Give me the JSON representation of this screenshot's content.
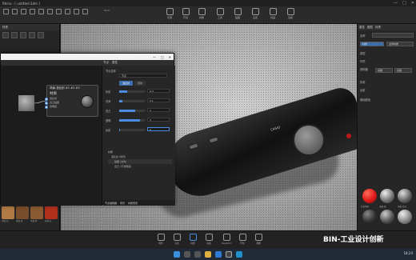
{
  "window": {
    "title": "Rhino - [ untitled.3dm ]",
    "controls": [
      "—",
      "□",
      "✕"
    ]
  },
  "toolbar": {
    "zoom_value": "50.0",
    "groups": [
      "选择",
      "变换",
      "视图",
      "渲染",
      "动画",
      "光照",
      "相机",
      "材质",
      "图层",
      "工具"
    ],
    "big_buttons": [
      "光源",
      "环境",
      "材质",
      "工具",
      "贴图",
      "设置",
      "动画",
      "渲染"
    ]
  },
  "left_panel": {
    "title": "材质",
    "thumbs": [
      "木纹-光",
      "木纹-深",
      "木纹-棕",
      "布料-红",
      "金属-灰",
      "金属-红",
      "玻璃",
      "塑料"
    ]
  },
  "dialog": {
    "title_controls": [
      "—",
      "□",
      "✕"
    ],
    "menu": [
      "节点",
      "属性"
    ],
    "node": {
      "header": "场景-漫反射 #1 #2 #3",
      "title": "材质",
      "ports": [
        "漫反射",
        "凹凸贴图",
        "透明度"
      ]
    },
    "props": {
      "name_label": "节点名称",
      "name_value": "节点",
      "tabs": [
        "漫反射",
        "折射"
      ],
      "rows": [
        {
          "label": "折射",
          "value": "0.3"
        },
        {
          "label": "光泽",
          "value": "0.1"
        },
        {
          "label": "凹凸",
          "value": "1"
        },
        {
          "label": "透明",
          "value": "2"
        },
        {
          "label": "反射",
          "value": "0"
        }
      ],
      "tree_title": "材质",
      "tree": [
        "漫反射 (场景)",
        "贴图 (文件)",
        "凹凸 (不透明度)"
      ],
      "footer": [
        "节点编辑器",
        "场景",
        "材质预览"
      ]
    }
  },
  "viewport": {
    "brand": "CASIO"
  },
  "right_panel": {
    "tabs": [
      "属性",
      "图层",
      "材质"
    ],
    "rows": [
      "名称",
      "类型",
      "环境",
      "透明度",
      "折射",
      "反射",
      "基础颜色"
    ],
    "buttons": [
      "材质",
      "全局材质",
      "基础",
      "高级"
    ],
    "materials": [
      "红色塑料",
      "金属-铬",
      "金属-拉丝",
      "橡胶-黑",
      "玻璃-烟",
      "金属-亮"
    ]
  },
  "bottom_bar": {
    "buttons": [
      "场景",
      "渲染",
      "材质",
      "动画",
      "KeyShot",
      "环境",
      "视图"
    ]
  },
  "watermark": "BIN-工业设计创新",
  "taskbar": {
    "time": "18:24"
  },
  "colors": {
    "accent": "#4a8de0",
    "red_material": "#e11a1a"
  }
}
